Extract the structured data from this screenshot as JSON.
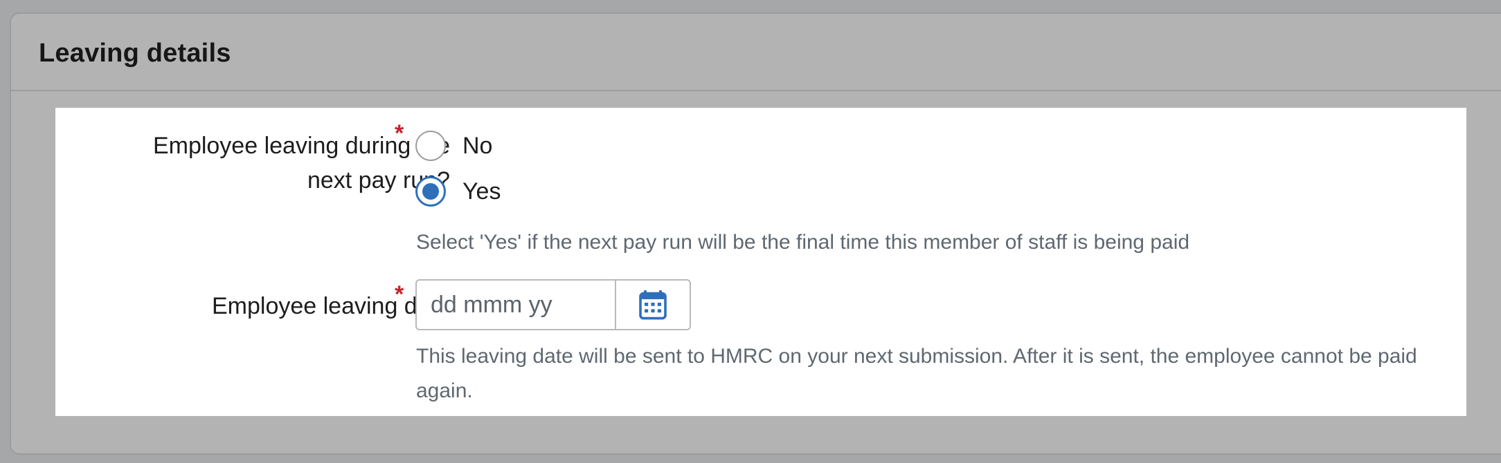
{
  "section": {
    "title": "Leaving details"
  },
  "leaving_next_pay_run": {
    "label_line1": "Employee leaving during the",
    "label_line2": "next pay run?",
    "required_mark": "*",
    "options": [
      {
        "label": "No",
        "selected": false
      },
      {
        "label": "Yes",
        "selected": true
      }
    ],
    "hint": "Select 'Yes' if the next pay run will be the final time this member of staff is being paid"
  },
  "leaving_date": {
    "label": "Employee leaving date",
    "required_mark": "*",
    "placeholder": "dd mmm yy",
    "value": "",
    "icon": "calendar-icon",
    "hint": "This leaving date will be sent to HMRC on your next submission. After it is sent, the employee cannot be paid again."
  },
  "colors": {
    "accent": "#2f6fb9",
    "required": "#c0262b",
    "hint_text": "#5f6770"
  }
}
